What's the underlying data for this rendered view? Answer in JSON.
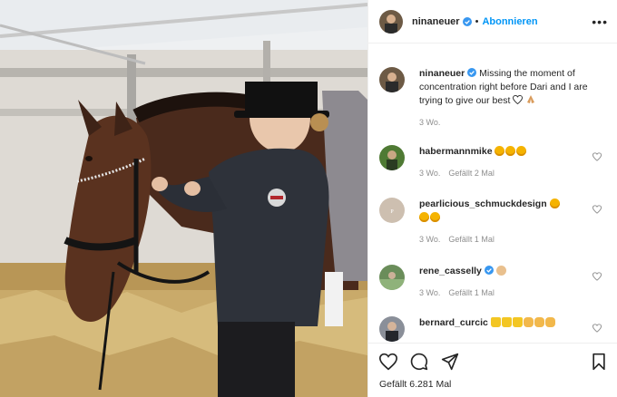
{
  "colors": {
    "accent": "#0095f6",
    "muted": "#8e8e8e",
    "text": "#262626"
  },
  "header": {
    "username": "ninaneuer",
    "separator": "•",
    "follow_label": "Abonnieren",
    "more_label": "•••"
  },
  "caption": {
    "username": "ninaneuer",
    "text": "Missing the moment of concentration right before Dari and I are trying to give our best",
    "time": "3 Wo."
  },
  "comments": [
    {
      "username": "habermannmike",
      "time": "3 Wo.",
      "likes": "Gefällt 2 Mal"
    },
    {
      "username": "pearlicious_schmuckdesign",
      "time": "3 Wo.",
      "likes": "Gefällt 1 Mal"
    },
    {
      "username": "rene_casselly",
      "time": "3 Wo.",
      "likes": "Gefällt 1 Mal"
    },
    {
      "username": "bernard_curcic"
    }
  ],
  "footer": {
    "likes": "Gefällt 6.281 Mal"
  },
  "icons": [
    "heart-icon",
    "comment-icon",
    "share-icon",
    "bookmark-icon",
    "verified-icon",
    "more-icon"
  ]
}
